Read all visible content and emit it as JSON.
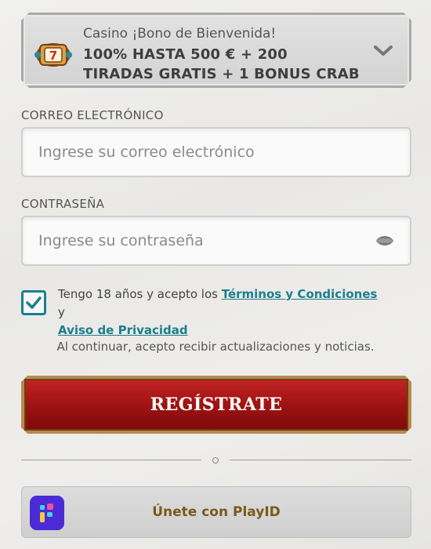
{
  "bonus": {
    "subtitle": "Casino ¡Bono de Bienvenida!",
    "title": "100% HASTA 500 € + 200 TIRADAS GRATIS + 1 BONUS CRAB",
    "icon": "slot-machine-icon",
    "toggle_icon": "chevron-down-icon"
  },
  "email": {
    "label": "CORREO ELECTRÓNICO",
    "placeholder": "Ingrese su correo electrónico",
    "value": ""
  },
  "password": {
    "label": "CONTRASEÑA",
    "placeholder": "Ingrese su contraseña",
    "value": "",
    "toggle_icon": "eye-icon"
  },
  "consent": {
    "checked": true,
    "text_before": "Tengo 18 años y acepto los ",
    "terms_link": "Términos y Condiciones",
    "text_between": " y",
    "privacy_link": "Aviso de Privacidad"
  },
  "updates_notice": "Al continuar, acepto recibir actualizaciones y noticias.",
  "register_button": "REGÍSTRATE",
  "playid": {
    "label": "Únete con PlayID",
    "icon": "playid-logo-icon"
  },
  "colors": {
    "accent": "#1b7f8d",
    "register_red": "#a01313",
    "register_border": "#b68a4c",
    "playid_purple": "#4a2bd6",
    "playid_text": "#7a5a1a"
  }
}
